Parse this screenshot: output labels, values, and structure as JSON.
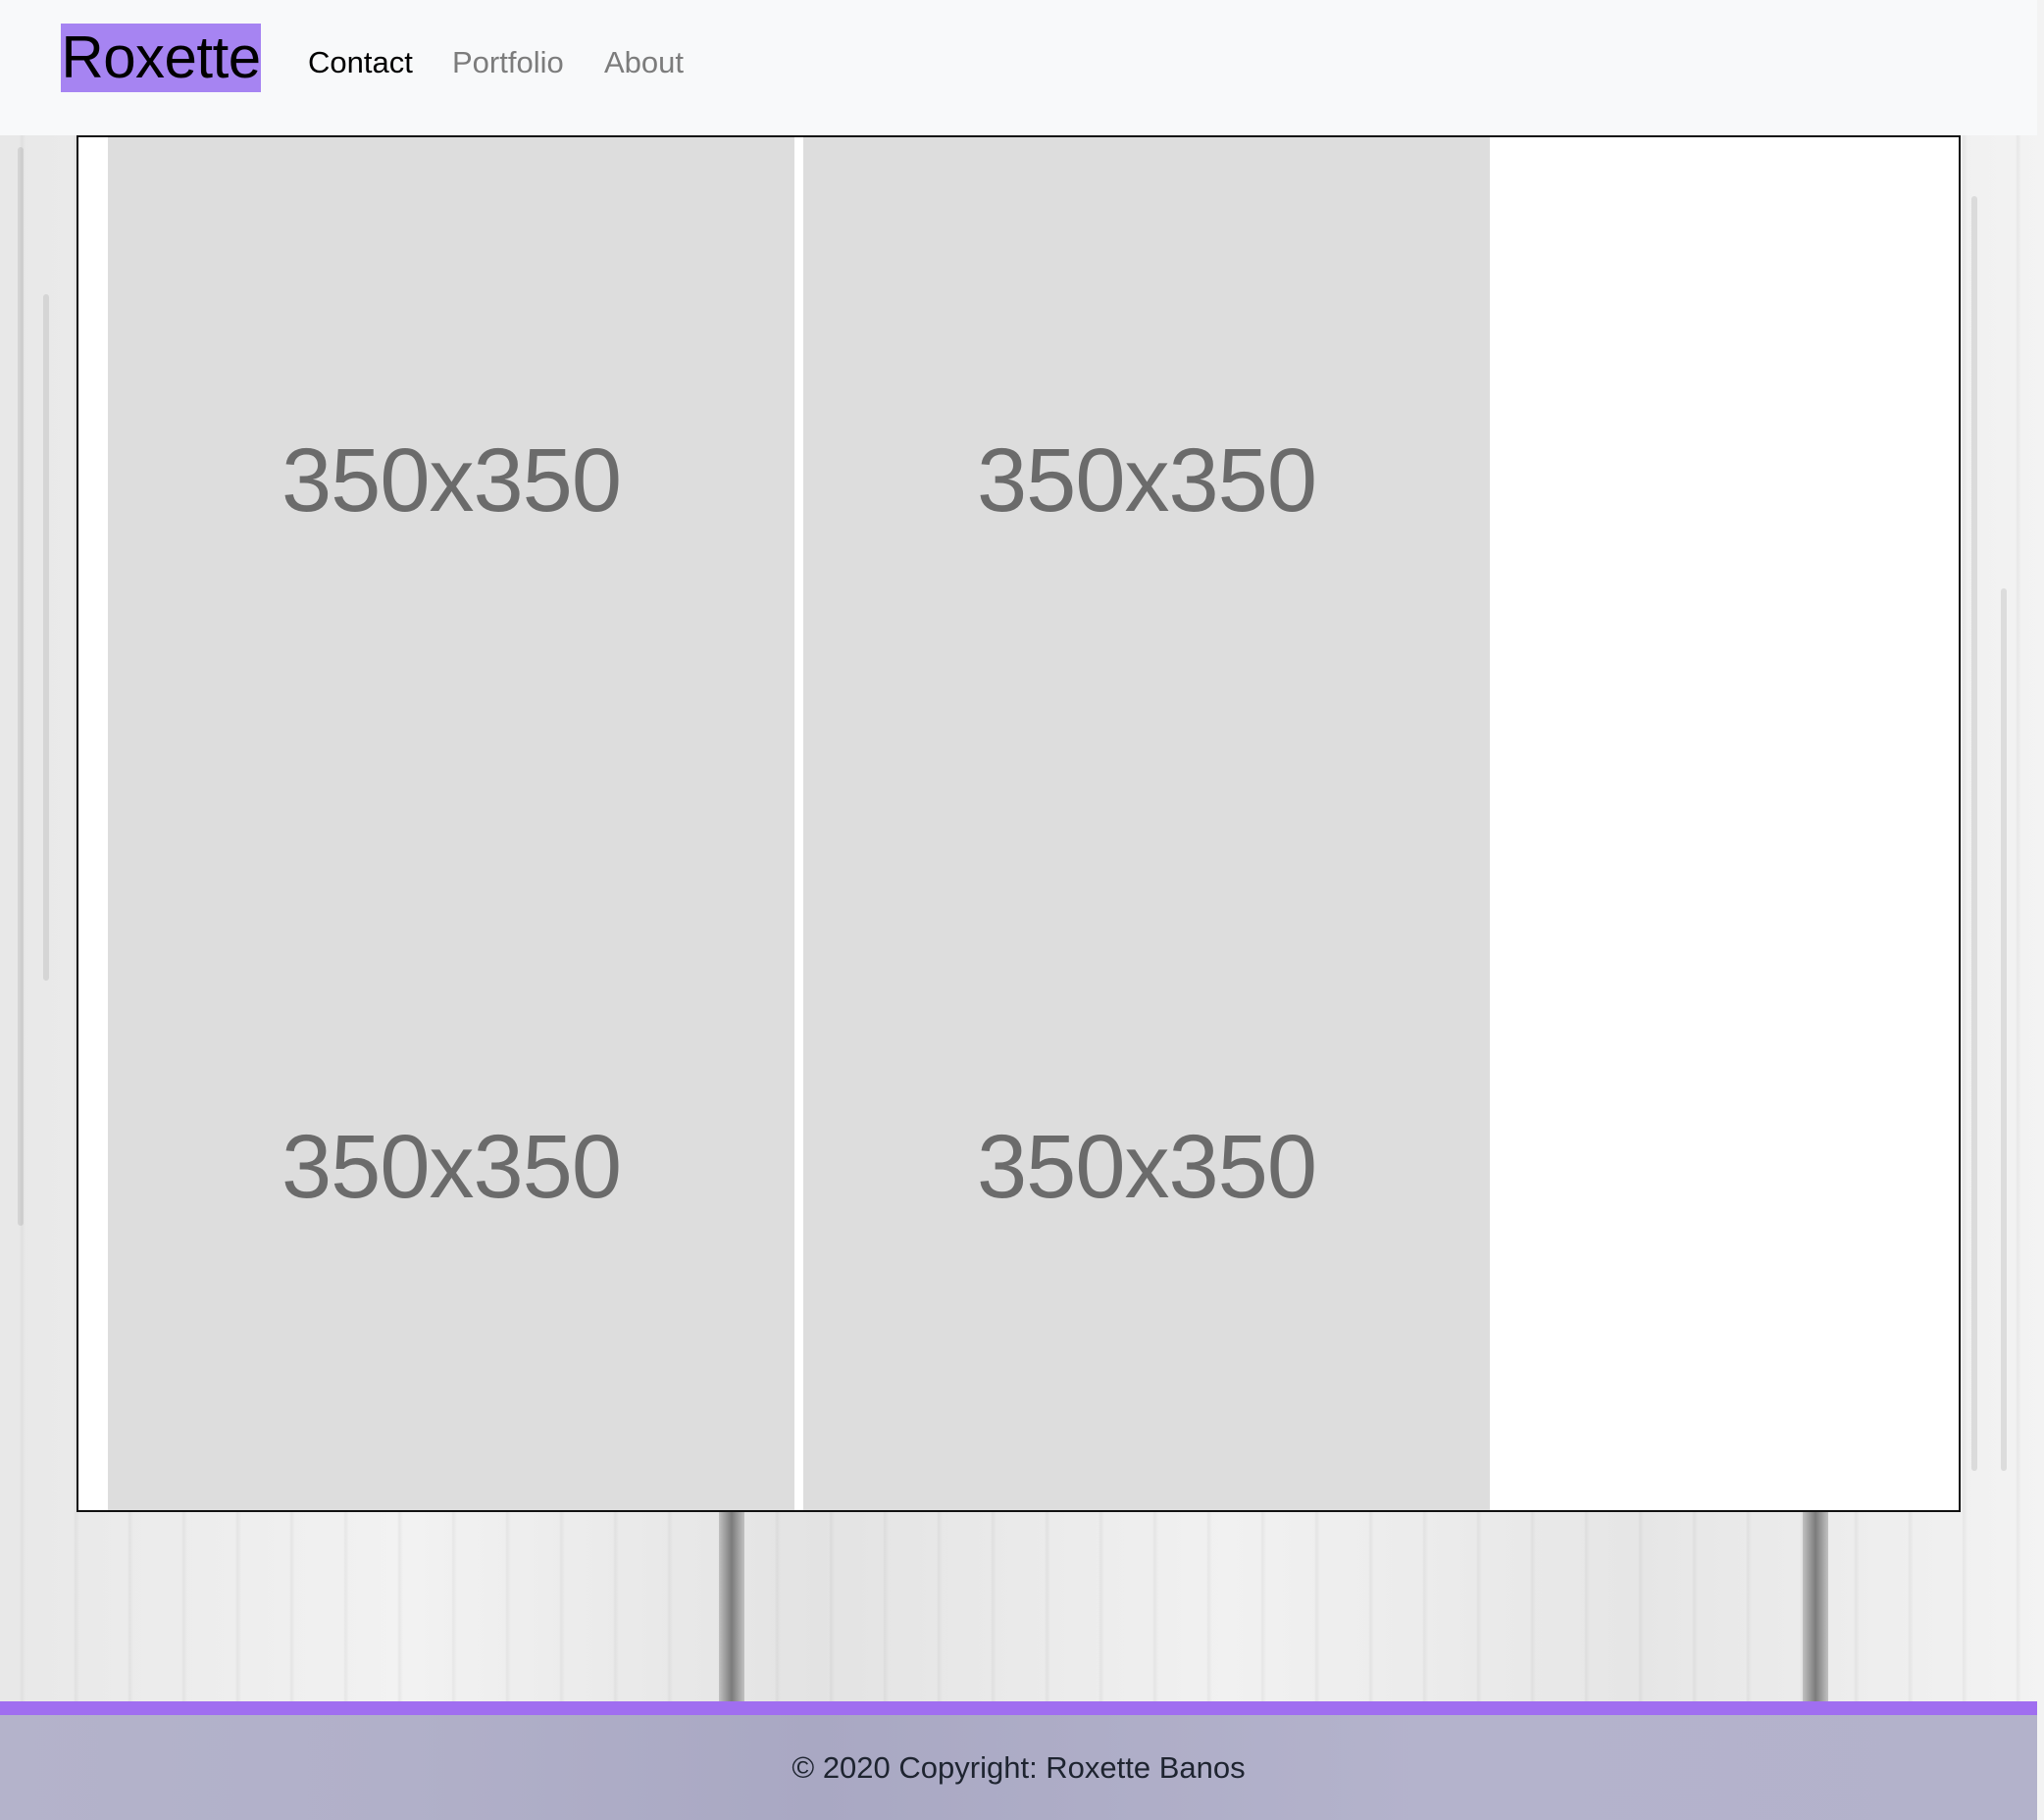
{
  "navbar": {
    "brand": "Roxette",
    "links": [
      {
        "label": "Contact",
        "active": true
      },
      {
        "label": "Portfolio",
        "active": false
      },
      {
        "label": "About",
        "active": false
      }
    ],
    "brand_color": "#a684f2"
  },
  "gallery": {
    "tiles": [
      {
        "label": "350x350"
      },
      {
        "label": "350x350"
      },
      {
        "label": "350x350"
      },
      {
        "label": "350x350"
      }
    ]
  },
  "footer": {
    "text": "© 2020 Copyright: Roxette Banos",
    "accent_color": "#a06ef0"
  }
}
